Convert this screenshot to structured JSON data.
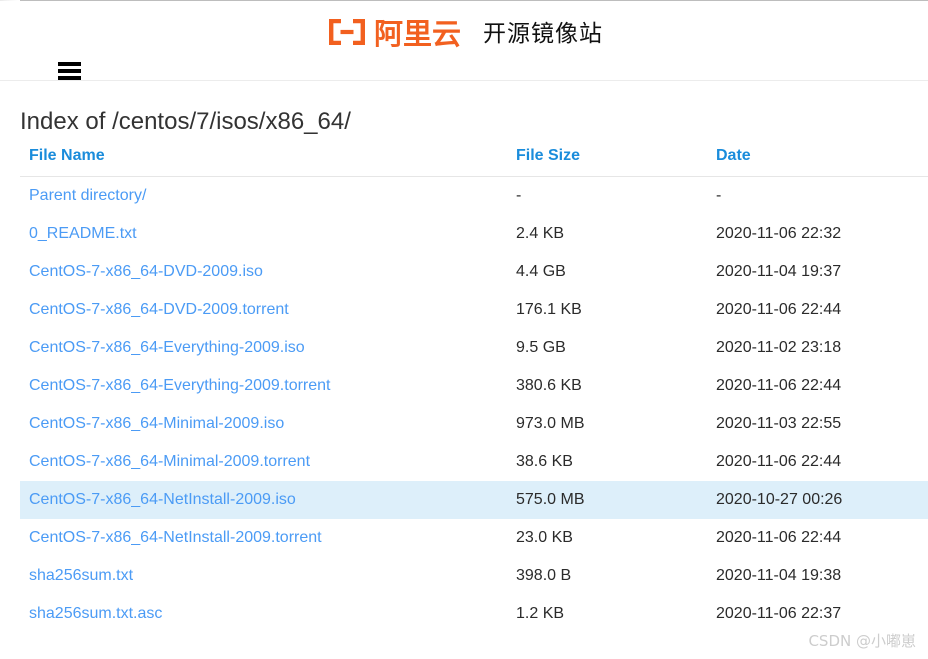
{
  "header": {
    "menu_icon": "hamburger-menu-icon",
    "brand": {
      "logo_mark": "[-]",
      "logo_text": "阿里云",
      "tagline": "开源镜像站",
      "brand_color": "#f2601f"
    }
  },
  "main": {
    "page_title": "Index of /centos/7/isos/x86_64/",
    "table": {
      "columns": [
        "File Name",
        "File Size",
        "Date"
      ],
      "selected_row_index": 8,
      "selected_row_color": "#ddeffa",
      "link_color": "#4b9bf5",
      "header_color": "#1a8cdb",
      "rows": [
        {
          "name": "Parent directory/",
          "size": "-",
          "date": "-"
        },
        {
          "name": "0_README.txt",
          "size": "2.4 KB",
          "date": "2020-11-06 22:32"
        },
        {
          "name": "CentOS-7-x86_64-DVD-2009.iso",
          "size": "4.4 GB",
          "date": "2020-11-04 19:37"
        },
        {
          "name": "CentOS-7-x86_64-DVD-2009.torrent",
          "size": "176.1 KB",
          "date": "2020-11-06 22:44"
        },
        {
          "name": "CentOS-7-x86_64-Everything-2009.iso",
          "size": "9.5 GB",
          "date": "2020-11-02 23:18"
        },
        {
          "name": "CentOS-7-x86_64-Everything-2009.torrent",
          "size": "380.6 KB",
          "date": "2020-11-06 22:44"
        },
        {
          "name": "CentOS-7-x86_64-Minimal-2009.iso",
          "size": "973.0 MB",
          "date": "2020-11-03 22:55"
        },
        {
          "name": "CentOS-7-x86_64-Minimal-2009.torrent",
          "size": "38.6 KB",
          "date": "2020-11-06 22:44"
        },
        {
          "name": "CentOS-7-x86_64-NetInstall-2009.iso",
          "size": "575.0 MB",
          "date": "2020-10-27 00:26"
        },
        {
          "name": "CentOS-7-x86_64-NetInstall-2009.torrent",
          "size": "23.0 KB",
          "date": "2020-11-06 22:44"
        },
        {
          "name": "sha256sum.txt",
          "size": "398.0 B",
          "date": "2020-11-04 19:38"
        },
        {
          "name": "sha256sum.txt.asc",
          "size": "1.2 KB",
          "date": "2020-11-06 22:37"
        }
      ]
    }
  },
  "watermark": {
    "text": "CSDN @小嘟崽"
  }
}
